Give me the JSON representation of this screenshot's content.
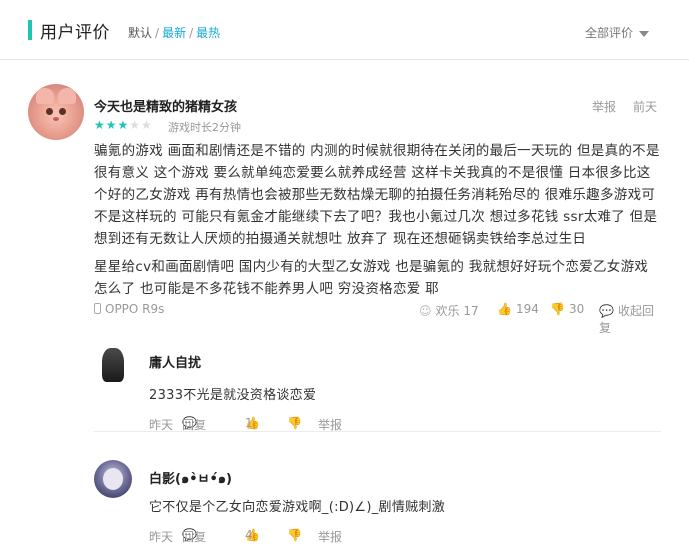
{
  "header": {
    "title": "用户评价",
    "sort_default": "默认",
    "sort_separator": "/",
    "sort_newest": "最新",
    "sort_hottest": "最热",
    "filter_label": "全部评价"
  },
  "review": {
    "author": "今天也是精致的猪精女孩",
    "rating": 3,
    "rating_max": 5,
    "stars_on": "★★★",
    "stars_off": "★★",
    "playtime": "游戏时长2分钟",
    "report_label": "举报",
    "date": "前天",
    "paragraphs": [
      "骗氪的游戏 画面和剧情还是不错的 内测的时候就很期待在关闭的最后一天玩的 但是真的不是很有意义 这个游戏 要么就单纯恋爱要么就养成经营 这样卡关我真的不是很懂 日本很多比这个好的乙女游戏 再有热情也会被那些无数枯燥无聊的拍摄任务消耗殆尽的 很难乐趣多游戏可不是这样玩的 可能只有氪金才能继续下去了吧？我也小氪过几次 想过多花钱 ssr太难了 但是想到还有无数让人厌烦的拍摄通关就想吐 放弃了 现在还想砸锅卖铁给李总过生日",
      "星星给cv和画面剧情吧 国内少有的大型乙女游戏 也是骗氪的 我就想好好玩个恋爱乙女游戏怎么了 也可能是不多花钱不能养男人吧 穷没资格恋爱 耶"
    ],
    "device": "OPPO R9s",
    "fun_label": "欢乐",
    "fun_count": "17",
    "upvotes": "194",
    "downvotes": "30",
    "collapse_label": "收起回复"
  },
  "replies": [
    {
      "name": "庸人自扰",
      "text": "2333不光是就没资格谈恋爱",
      "date": "昨天",
      "reply_label": "回复",
      "upvotes": "1",
      "report_label": "举报"
    },
    {
      "name": "白影(๑•̀ㅂ•́๑)",
      "text": "它不仅是个乙女向恋爱游戏啊_(:D)∠)_剧情贼刺激",
      "date": "昨天",
      "reply_label": "回复",
      "upvotes": "4",
      "report_label": "举报"
    }
  ],
  "colors": {
    "accent": "#1fc5b3",
    "link": "#1aa9d6",
    "muted": "#999999"
  }
}
